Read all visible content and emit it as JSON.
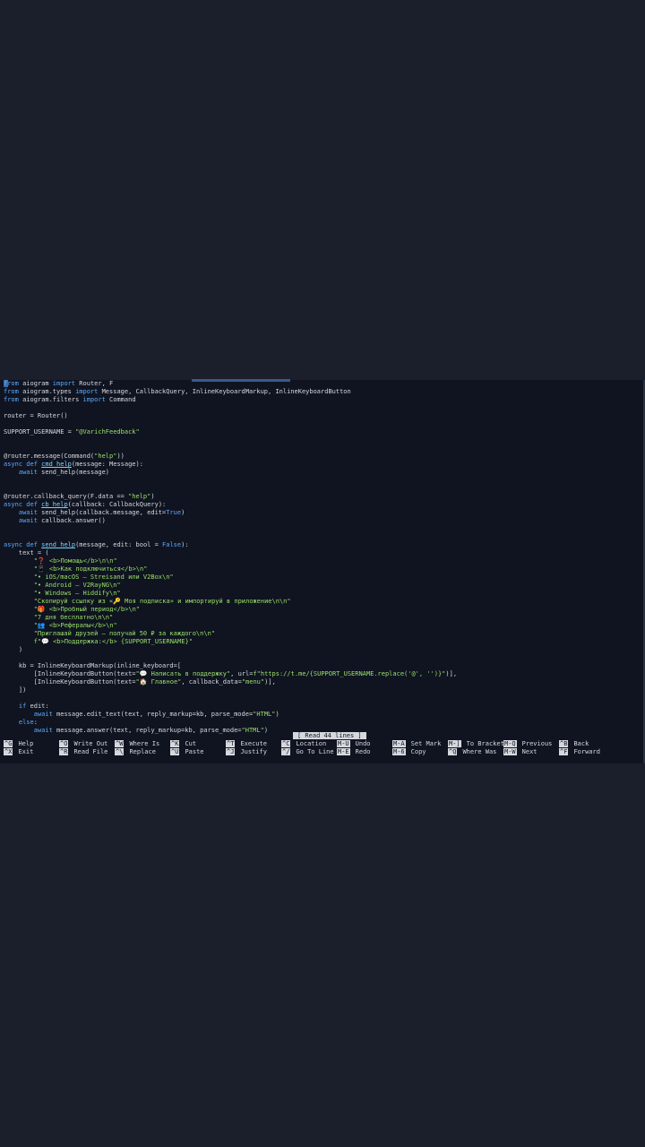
{
  "code_lines": [
    [
      {
        "t": "from",
        "c": "kw"
      },
      {
        "t": " aiogram ",
        "c": "plain"
      },
      {
        "t": "import",
        "c": "kw"
      },
      {
        "t": " Router, F",
        "c": "plain"
      }
    ],
    [
      {
        "t": "from",
        "c": "kw"
      },
      {
        "t": " aiogram.types ",
        "c": "plain"
      },
      {
        "t": "import",
        "c": "kw"
      },
      {
        "t": " Message, CallbackQuery, InlineKeyboardMarkup, InlineKeyboardButton",
        "c": "plain"
      }
    ],
    [
      {
        "t": "from",
        "c": "kw"
      },
      {
        "t": " aiogram.filters ",
        "c": "plain"
      },
      {
        "t": "import",
        "c": "kw"
      },
      {
        "t": " Command",
        "c": "plain"
      }
    ],
    [],
    [
      {
        "t": "router = Router()",
        "c": "plain"
      }
    ],
    [],
    [
      {
        "t": "SUPPORT_USERNAME = ",
        "c": "plain"
      },
      {
        "t": "\"@VarichFeedback\"",
        "c": "str"
      }
    ],
    [],
    [],
    [
      {
        "t": "@router.message(Command(",
        "c": "plain"
      },
      {
        "t": "\"help\"",
        "c": "str"
      },
      {
        "t": "))",
        "c": "plain"
      }
    ],
    [
      {
        "t": "async def ",
        "c": "kw"
      },
      {
        "t": "cmd_help",
        "c": "fn"
      },
      {
        "t": "(message: Message):",
        "c": "plain"
      }
    ],
    [
      {
        "t": "    await",
        "c": "kw"
      },
      {
        "t": " send_help(message)",
        "c": "plain"
      }
    ],
    [],
    [],
    [
      {
        "t": "@router.callback_query(F.data == ",
        "c": "plain"
      },
      {
        "t": "\"help\"",
        "c": "str"
      },
      {
        "t": ")",
        "c": "plain"
      }
    ],
    [
      {
        "t": "async def ",
        "c": "kw"
      },
      {
        "t": "cb_help",
        "c": "fn"
      },
      {
        "t": "(callback: CallbackQuery):",
        "c": "plain"
      }
    ],
    [
      {
        "t": "    await",
        "c": "kw"
      },
      {
        "t": " send_help(callback.message, edit=",
        "c": "plain"
      },
      {
        "t": "True",
        "c": "kw"
      },
      {
        "t": ")",
        "c": "plain"
      }
    ],
    [
      {
        "t": "    await",
        "c": "kw"
      },
      {
        "t": " callback.answer()",
        "c": "plain"
      }
    ],
    [],
    [],
    [
      {
        "t": "async def ",
        "c": "kw"
      },
      {
        "t": "send_help",
        "c": "fn"
      },
      {
        "t": "(message, edit: bool = ",
        "c": "plain"
      },
      {
        "t": "False",
        "c": "kw"
      },
      {
        "t": "):",
        "c": "plain"
      }
    ],
    [
      {
        "t": "    text = (",
        "c": "plain"
      }
    ],
    [
      {
        "t": "        \"❓ <b>Помощь</b>\\n\\n\"",
        "c": "str"
      }
    ],
    [
      {
        "t": "        \"📱 <b>Как подключиться</b>\\n\"",
        "c": "str"
      }
    ],
    [
      {
        "t": "        \"• iOS/macOS — Streisand или V2Box\\n\"",
        "c": "str"
      }
    ],
    [
      {
        "t": "        \"• Android — V2RayNG\\n\"",
        "c": "str"
      }
    ],
    [
      {
        "t": "        \"• Windows — Hiddify\\n\"",
        "c": "str"
      }
    ],
    [
      {
        "t": "        \"Скопируй ссылку из «🔑 Моя подписка» и импортируй в приложение\\n\\n\"",
        "c": "str"
      }
    ],
    [
      {
        "t": "        \"🎁 <b>Пробный период</b>\\n\"",
        "c": "str"
      }
    ],
    [
      {
        "t": "        \"7 дня бесплатно\\n\\n\"",
        "c": "str"
      }
    ],
    [
      {
        "t": "        \"👥 <b>Рефералы</b>\\n\"",
        "c": "str"
      }
    ],
    [
      {
        "t": "        \"Приглашай друзей — получай 50 ₽ за каждого\\n\\n\"",
        "c": "str"
      }
    ],
    [
      {
        "t": "        f\"💬 <b>Поддержка:</b> {SUPPORT_USERNAME}\"",
        "c": "str"
      }
    ],
    [
      {
        "t": "    )",
        "c": "plain"
      }
    ],
    [],
    [
      {
        "t": "    kb = InlineKeyboardMarkup(inline_keyboard=[",
        "c": "plain"
      }
    ],
    [
      {
        "t": "        [InlineKeyboardButton(text=",
        "c": "plain"
      },
      {
        "t": "\"💬 Написать в поддержку\"",
        "c": "str"
      },
      {
        "t": ", url=",
        "c": "plain"
      },
      {
        "t": "f\"https://t.me/{SUPPORT_USERNAME.replace('@', '')}\"",
        "c": "str"
      },
      {
        "t": ")],",
        "c": "plain"
      }
    ],
    [
      {
        "t": "        [InlineKeyboardButton(text=",
        "c": "plain"
      },
      {
        "t": "\"🏠 Главное\"",
        "c": "str"
      },
      {
        "t": ", callback_data=",
        "c": "plain"
      },
      {
        "t": "\"menu\"",
        "c": "str"
      },
      {
        "t": ")],",
        "c": "plain"
      }
    ],
    [
      {
        "t": "    ])",
        "c": "plain"
      }
    ],
    [],
    [
      {
        "t": "    if",
        "c": "kw"
      },
      {
        "t": " edit:",
        "c": "plain"
      }
    ],
    [
      {
        "t": "        await",
        "c": "kw"
      },
      {
        "t": " message.edit_text(text, reply_markup=kb, parse_mode=",
        "c": "plain"
      },
      {
        "t": "\"HTML\"",
        "c": "str"
      },
      {
        "t": ")",
        "c": "plain"
      }
    ],
    [
      {
        "t": "    else",
        "c": "kw"
      },
      {
        "t": ":",
        "c": "plain"
      }
    ],
    [
      {
        "t": "        await",
        "c": "kw"
      },
      {
        "t": " message.answer(text, reply_markup=kb, parse_mode=",
        "c": "plain"
      },
      {
        "t": "\"HTML\"",
        "c": "str"
      },
      {
        "t": ")",
        "c": "plain"
      }
    ]
  ],
  "status": "[ Read 44 lines ]",
  "shortcuts": [
    {
      "key": "^G",
      "label": "Help"
    },
    {
      "key": "^O",
      "label": "Write Out"
    },
    {
      "key": "^W",
      "label": "Where Is"
    },
    {
      "key": "^K",
      "label": "Cut"
    },
    {
      "key": "^T",
      "label": "Execute"
    },
    {
      "key": "^C",
      "label": "Location"
    },
    {
      "key": "M-U",
      "label": "Undo"
    },
    {
      "key": "M-A",
      "label": "Set Mark"
    },
    {
      "key": "M-]",
      "label": "To Bracket"
    },
    {
      "key": "M-Q",
      "label": "Previous"
    },
    {
      "key": "^B",
      "label": "Back"
    },
    {
      "key": "^X",
      "label": "Exit"
    },
    {
      "key": "^R",
      "label": "Read File"
    },
    {
      "key": "^\\",
      "label": "Replace"
    },
    {
      "key": "^U",
      "label": "Paste"
    },
    {
      "key": "^J",
      "label": "Justify"
    },
    {
      "key": "^/",
      "label": "Go To Line"
    },
    {
      "key": "M-E",
      "label": "Redo"
    },
    {
      "key": "M-6",
      "label": "Copy"
    },
    {
      "key": "^Q",
      "label": "Where Was"
    },
    {
      "key": "M-W",
      "label": "Next"
    },
    {
      "key": "^F",
      "label": "Forward"
    }
  ]
}
